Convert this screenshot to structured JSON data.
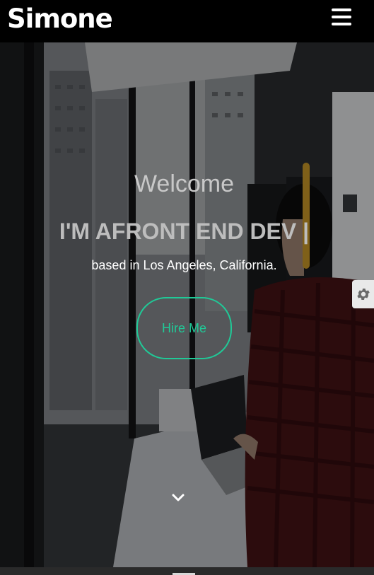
{
  "header": {
    "brand": "Simone",
    "menu_icon": "hamburger-menu-icon"
  },
  "hero": {
    "welcome": "Welcome",
    "headline": "I'M AFRONT END DEV |",
    "location": "based in Los Angeles, California.",
    "cta_label": "Hire Me",
    "scroll_icon": "chevron-down-icon"
  },
  "settings": {
    "icon": "gear-icon"
  },
  "colors": {
    "accent": "#20c997",
    "header_bg": "#000000",
    "text_light": "#ffffff"
  }
}
